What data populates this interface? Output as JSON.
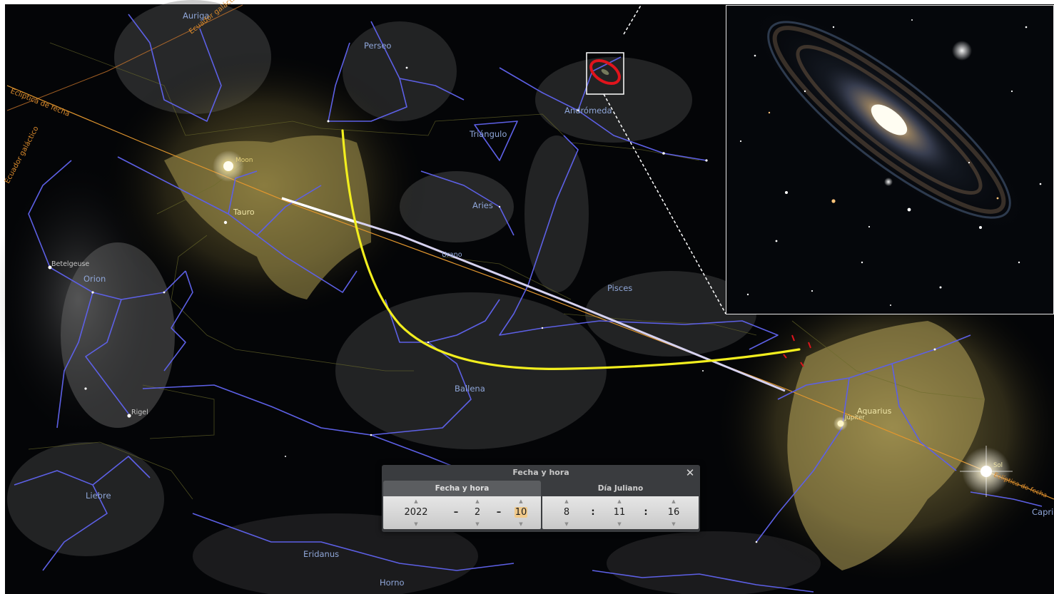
{
  "sky_labels": {
    "auriga": "Auriga",
    "ecuador_galactico_top": "Ecuador galáctico",
    "ecuador_galactico_left": "Ecuador galáctico",
    "ecliptica": "Eclíptica de fecha",
    "ecliptica_right": "Eclíptica de fecha",
    "perseo": "Perseo",
    "andromeda": "Andrómeda",
    "triangulo": "Triángulo",
    "moon": "Moon",
    "tauro": "Tauro",
    "aries": "Aries",
    "urano": "Urano",
    "betelgeuse": "Betelgeuse",
    "orion": "Orion",
    "piscis": "Pisces",
    "ballena": "Ballena",
    "rigel": "Rigel",
    "liebre": "Liebre",
    "eridanus": "Eridanus",
    "horno": "Horno",
    "acuario": "Aquarius",
    "jupiter": "Júpiter",
    "sol": "Sol",
    "capricornio": "Capri"
  },
  "colors": {
    "constellation_lines": "#5d60e6",
    "trajectory": "#f2ee1e",
    "ecliptic": "#d98a2c",
    "labels": "#8fa6d8",
    "selection_box": "#ffffff",
    "target_marker": "#e0141c"
  },
  "dialog": {
    "title": "Fecha y hora",
    "close_icon": "close-icon",
    "tabs": [
      "Fecha y hora",
      "Día Juliano"
    ],
    "date": {
      "year": "2022",
      "month": "2",
      "day": "10",
      "sep": "–"
    },
    "time": {
      "hour": "8",
      "minute": "11",
      "second": "16",
      "sep": ":"
    },
    "spin_up": "▲",
    "spin_down": "▼"
  }
}
